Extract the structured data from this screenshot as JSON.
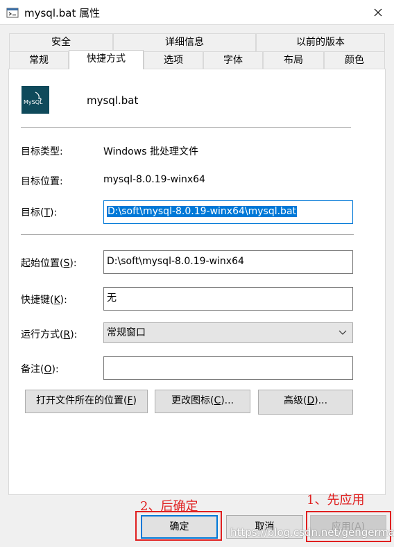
{
  "window": {
    "title": "mysql.bat 属性",
    "icon": "batch-file-icon",
    "close_icon": "close-icon"
  },
  "tabs": {
    "row1": [
      "安全",
      "详细信息",
      "以前的版本"
    ],
    "row2": [
      "常规",
      "快捷方式",
      "选项",
      "字体",
      "布局",
      "颜色"
    ],
    "active": "快捷方式"
  },
  "shortcut": {
    "icon": "mysql-logo-icon",
    "icon_text": "MySQL",
    "name": "mysql.bat",
    "target_type_label": "目标类型:",
    "target_type_value": "Windows 批处理文件",
    "target_location_label": "目标位置:",
    "target_location_value": "mysql-8.0.19-winx64",
    "target_label": "目标(",
    "target_key": "T",
    "target_label_end": "):",
    "target_value": "D:\\soft\\mysql-8.0.19-winx64\\mysql.bat",
    "start_in_label": "起始位置(",
    "start_in_key": "S",
    "start_in_label_end": "):",
    "start_in_value": "D:\\soft\\mysql-8.0.19-winx64",
    "hotkey_label": "快捷键(",
    "hotkey_key": "K",
    "hotkey_label_end": "):",
    "hotkey_value": "无",
    "run_label": "运行方式(",
    "run_key": "R",
    "run_label_end": "):",
    "run_value": "常规窗口",
    "comment_label": "备注(",
    "comment_key": "O",
    "comment_label_end": "):",
    "comment_value": ""
  },
  "buttons": {
    "open_location": "打开文件所在的位置(",
    "open_location_key": "F",
    "open_location_end": ")",
    "change_icon": "更改图标(",
    "change_icon_key": "C",
    "change_icon_end": ")...",
    "advanced": "高级(",
    "advanced_key": "D",
    "advanced_end": ")..."
  },
  "dialog_buttons": {
    "ok": "确定",
    "cancel": "取消",
    "apply": "应用(A)"
  },
  "annotations": {
    "step1": "1、先应用",
    "step2": "2、后确定",
    "color": "#e02020"
  },
  "watermark": "https://blog.csdn.net/gengermao",
  "colors": {
    "accent": "#0078d7",
    "panel": "#ffffff",
    "background": "#f0f0f0"
  }
}
